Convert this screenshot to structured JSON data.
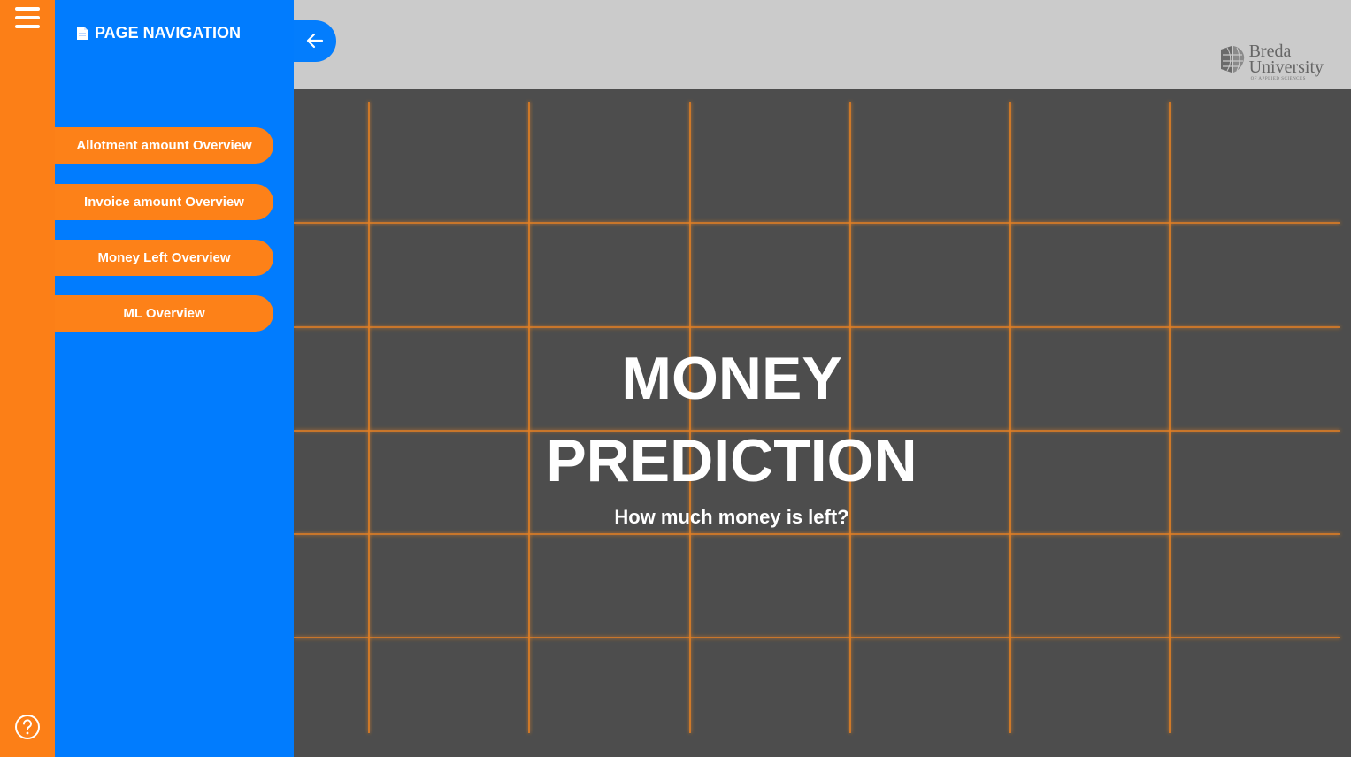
{
  "sidebar": {
    "menu_icon": "hamburger-icon",
    "help_icon": "question-circle-icon",
    "rail_color": "#fc7f17"
  },
  "nav_panel": {
    "title": "PAGE NAVIGATION",
    "title_icon": "document-icon",
    "color": "#017cfe",
    "items": [
      {
        "label": "Allotment amount Overview"
      },
      {
        "label": "Invoice amount Overview"
      },
      {
        "label": "Money Left Overview"
      },
      {
        "label": "ML Overview"
      }
    ],
    "button_color": "#fd8118"
  },
  "topbar": {
    "back_icon": "arrow-left-icon",
    "logo": {
      "line1": "Breda",
      "line2": "University",
      "line3": "OF APPLIED SCIENCES"
    }
  },
  "main": {
    "title_line1": "MONEY",
    "title_line2": "PREDICTION",
    "subtitle": "How much money is left?",
    "background": "#4d4d4d",
    "grid_color": "#ff8a1f"
  }
}
